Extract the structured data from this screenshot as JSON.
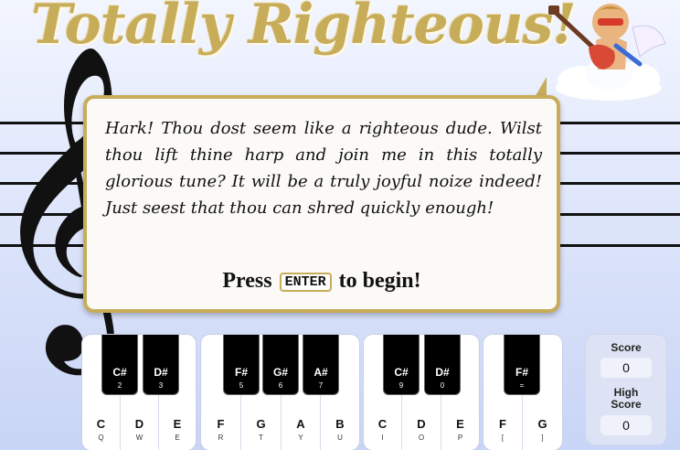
{
  "title": "Totally Righteous!",
  "dialog": {
    "message": "Hark! Thou dost seem like a righteous dude. Wilst thou lift thine harp and join me in this totally glorious tune? It will be a truly joyful noize indeed! Just seest that thou can shred quickly enough!",
    "press_before": "Press",
    "key": "ENTER",
    "press_after": "to begin!"
  },
  "piano": {
    "groups": [
      {
        "white": [
          {
            "note": "C",
            "key": "Q"
          },
          {
            "note": "D",
            "key": "W"
          },
          {
            "note": "E",
            "key": "E"
          }
        ],
        "black": [
          {
            "note": "C#",
            "key": "2"
          },
          {
            "note": "D#",
            "key": "3"
          }
        ]
      },
      {
        "white": [
          {
            "note": "F",
            "key": "R"
          },
          {
            "note": "G",
            "key": "T"
          },
          {
            "note": "A",
            "key": "Y"
          },
          {
            "note": "B",
            "key": "U"
          }
        ],
        "black": [
          {
            "note": "F#",
            "key": "5"
          },
          {
            "note": "G#",
            "key": "6"
          },
          {
            "note": "A#",
            "key": "7"
          }
        ]
      },
      {
        "white": [
          {
            "note": "C",
            "key": "I"
          },
          {
            "note": "D",
            "key": "O"
          },
          {
            "note": "E",
            "key": "P"
          }
        ],
        "black": [
          {
            "note": "C#",
            "key": "9"
          },
          {
            "note": "D#",
            "key": "0"
          }
        ]
      },
      {
        "white": [
          {
            "note": "F",
            "key": "["
          },
          {
            "note": "G",
            "key": "]"
          }
        ],
        "black": [
          {
            "note": "F#",
            "key": "="
          }
        ]
      }
    ]
  },
  "score": {
    "label": "Score",
    "value": "0",
    "high_label_1": "High",
    "high_label_2": "Score",
    "high_value": "0"
  },
  "colors": {
    "gold": "#c7ac5a",
    "background_top": "#f3f6ff",
    "background_bottom": "#c8d5f6"
  },
  "icons": {
    "clef": "treble-clef-icon",
    "mascot": "cupid-with-guitar-icon"
  }
}
